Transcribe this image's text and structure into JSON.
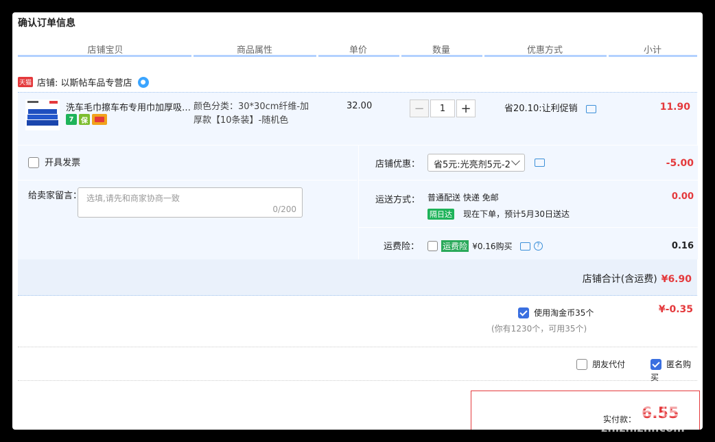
{
  "page_title": "确认订单信息",
  "columns": [
    "店铺宝贝",
    "商品属性",
    "单价",
    "数量",
    "优惠方式",
    "小计"
  ],
  "shop": {
    "tmall_tag": "天猫",
    "name": "店铺: 以斯帖车品专营店"
  },
  "item": {
    "name": "洗车毛巾擦车布专用巾加厚吸水...",
    "attr": "颜色分类：30*30cm纤维-加厚款【10条装】-随机色",
    "price": "32.00",
    "quantity": "1",
    "promo": "省20.10:让利促销",
    "subtotal": "11.90",
    "badges": [
      "7",
      "保",
      ""
    ]
  },
  "invoice_label": "开具发票",
  "memo": {
    "label": "给卖家留言：",
    "placeholder": "选填,请先和商家协商一致",
    "counter": "0/200"
  },
  "shop_discount": {
    "label": "店铺优惠：",
    "selected": "省5元:光亮剂5元-2",
    "value": "-5.00"
  },
  "shipping": {
    "label": "运送方式：",
    "method": "普通配送 快递 免邮",
    "tag": "隔日达",
    "eta": "现在下单，预计5月30日送达",
    "value": "0.00"
  },
  "insurance": {
    "label": "运费险：",
    "tag": "运费险",
    "price": "¥0.16购买",
    "value": "0.16"
  },
  "shop_total": {
    "label": "店铺合计(含运费)",
    "value": "¥6.90"
  },
  "coins": {
    "label": "使用淘金币35个",
    "note": "(你有1230个，可用35个)",
    "value": "¥-0.35"
  },
  "friend_pay": "朋友代付",
  "anonymous": "匿名购买",
  "final": {
    "label": "实付款：",
    "value": "6.55"
  },
  "watermark": {
    "big": "值值值",
    "small": "zhizhizhi.com"
  },
  "colors": {
    "accent": "#e4393c",
    "header_line": "#b2d1ff",
    "row_bg": "#f2f7ff",
    "checkbox": "#3a6fe0"
  }
}
